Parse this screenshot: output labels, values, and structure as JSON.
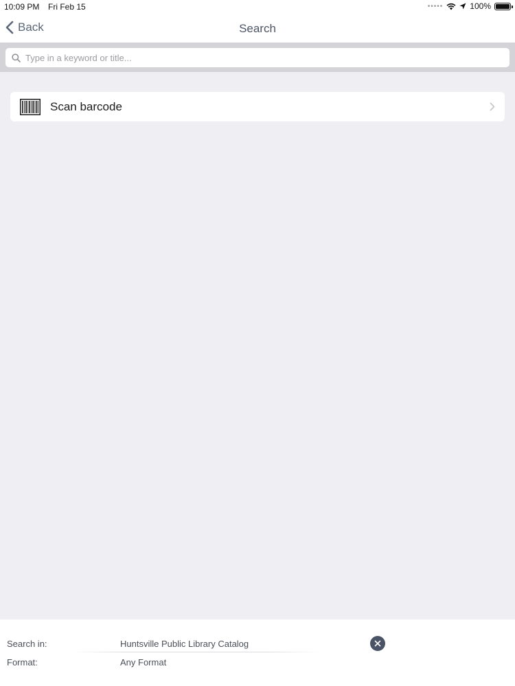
{
  "status_bar": {
    "time": "10:09 PM",
    "date": "Fri Feb 15",
    "battery": "100%",
    "battery_level": 1.0
  },
  "nav": {
    "back_label": "Back",
    "title": "Search"
  },
  "search": {
    "placeholder": "Type in a keyword or title...",
    "value": ""
  },
  "list": {
    "items": [
      {
        "label": "Scan barcode",
        "icon": "barcode-icon"
      }
    ]
  },
  "footer": {
    "search_in_label": "Search in:",
    "search_in_value": "Huntsville Public Library Catalog",
    "format_label": "Format:",
    "format_value": "Any Format"
  },
  "colors": {
    "background": "#efeef3",
    "search_strip": "#d3d3d8",
    "nav_text": "#5a6678",
    "clear_button": "#4a5466"
  }
}
